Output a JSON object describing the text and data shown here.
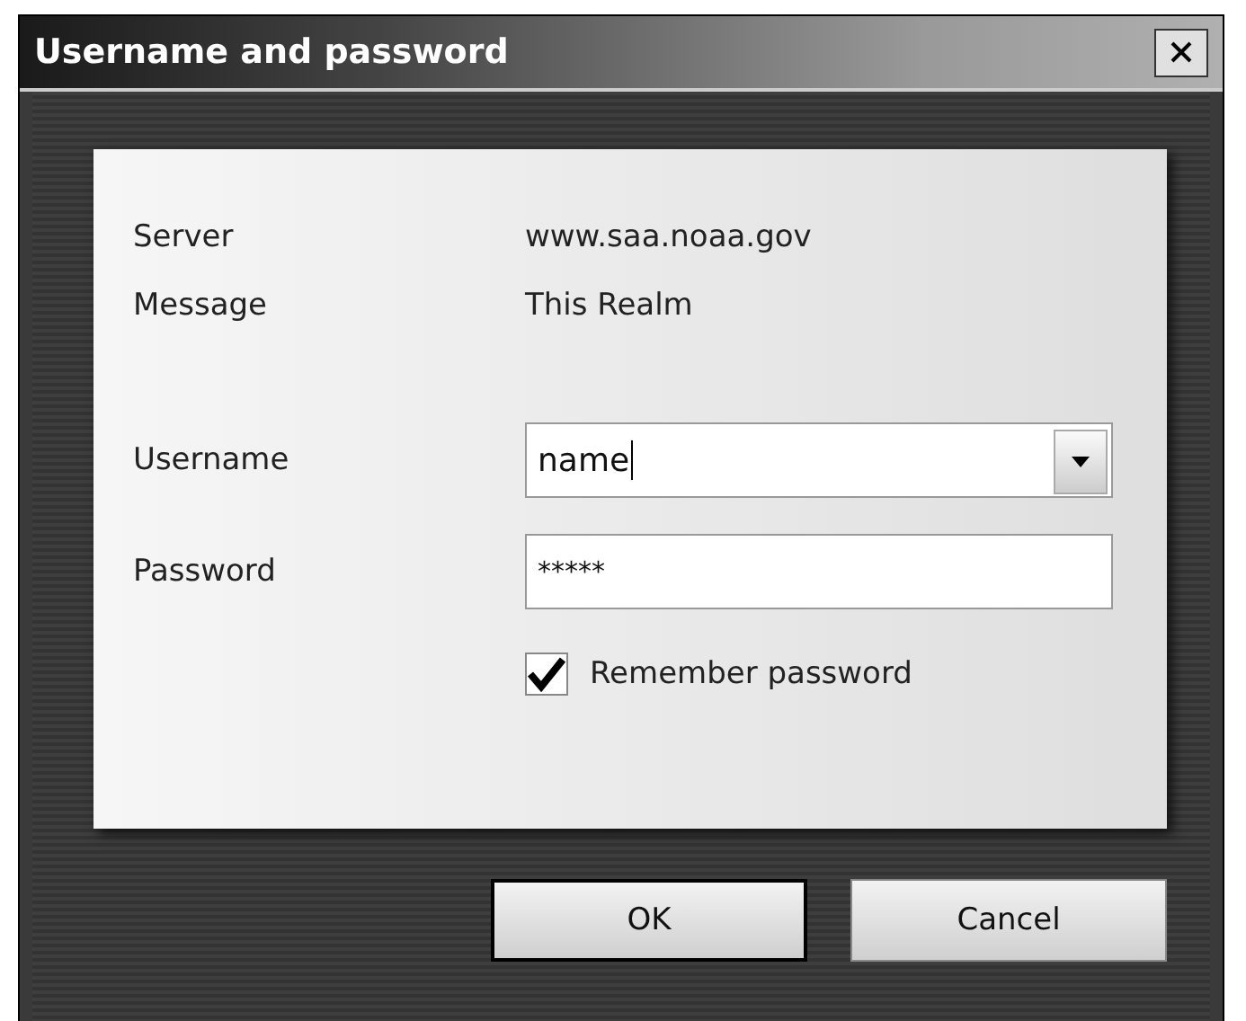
{
  "window": {
    "title": "Username and password"
  },
  "info": [
    {
      "label": "Server",
      "value": "www.saa.noaa.gov"
    },
    {
      "label": "Message",
      "value": "This Realm"
    }
  ],
  "fields": [
    {
      "kind": "combo",
      "label": "Username",
      "value": "name"
    },
    {
      "kind": "password",
      "label": "Password",
      "value": "*****"
    }
  ],
  "remember": {
    "label": "Remember password",
    "checked": true
  },
  "buttons": [
    {
      "label": "OK",
      "selected": true
    },
    {
      "label": "Cancel",
      "selected": false
    }
  ]
}
